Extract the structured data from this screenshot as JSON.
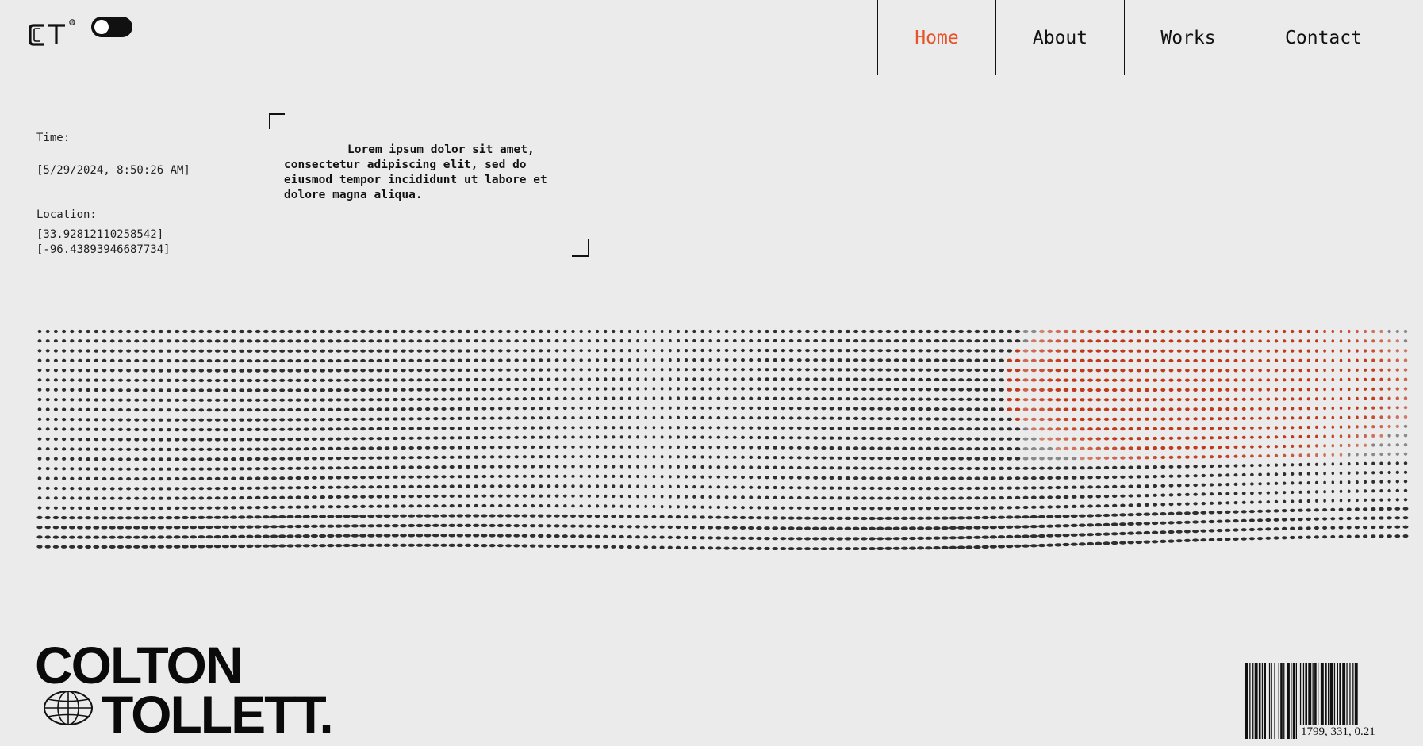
{
  "brand": {
    "logo_text": "CT",
    "registered_mark": "®"
  },
  "theme_toggle": {
    "state": "dark"
  },
  "nav": {
    "items": [
      {
        "label": "Home",
        "active": true
      },
      {
        "label": "About",
        "active": false
      },
      {
        "label": "Works",
        "active": false
      },
      {
        "label": "Contact",
        "active": false
      }
    ],
    "active_color": "#e8532b"
  },
  "info": {
    "time_label": "Time:",
    "time_value": "[5/29/2024, 8:50:26 AM]",
    "location_label": "Location:",
    "latitude": "[33.92812110258542]",
    "longitude": "[-96.43893946687734]"
  },
  "intro": {
    "text": "Lorem ipsum dolor sit amet, consectetur adipiscing elit, sed do eiusmod tempor incididunt ut labore et dolore magna aliqua."
  },
  "hero": {
    "dot_color": "#2e2e2e",
    "accent_color": "#c0391a"
  },
  "footer": {
    "name_line1": "COLTON",
    "name_line2": "TOLLETT.",
    "barcode_label": "1799, 331, 0.21"
  }
}
